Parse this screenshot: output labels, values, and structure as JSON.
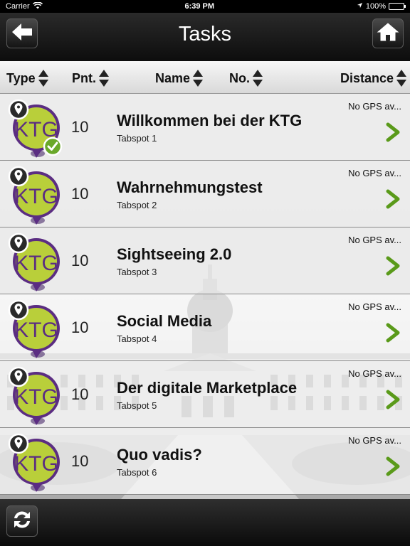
{
  "status_bar": {
    "carrier": "Carrier",
    "time": "6:39 PM",
    "battery": "100%",
    "battery_level": 1.0
  },
  "header": {
    "title": "Tasks",
    "back_icon": "arrow-left-icon",
    "home_icon": "home-icon"
  },
  "columns": [
    {
      "label": "Type"
    },
    {
      "label": "Pnt."
    },
    {
      "label": "Name"
    },
    {
      "label": "No."
    },
    {
      "label": "Distance"
    }
  ],
  "logo_text": "KTG",
  "colors": {
    "accent_green": "#5a9a1a",
    "logo_green": "#b9cf3a",
    "logo_purple": "#5b2d82"
  },
  "tasks": [
    {
      "points": "10",
      "title": "Willkommen bei der KTG",
      "subtitle": "Tabspot 1",
      "distance": "No GPS av...",
      "completed": true
    },
    {
      "points": "10",
      "title": "Wahrnehmungstest",
      "subtitle": "Tabspot 2",
      "distance": "No GPS av...",
      "completed": false
    },
    {
      "points": "10",
      "title": "Sightseeing 2.0",
      "subtitle": "Tabspot 3",
      "distance": "No GPS av...",
      "completed": false
    },
    {
      "points": "10",
      "title": "Social Media",
      "subtitle": "Tabspot 4",
      "distance": "No GPS av...",
      "completed": false
    },
    {
      "points": "10",
      "title": "Der digitale Marketplace",
      "subtitle": "Tabspot 5",
      "distance": "No GPS av...",
      "completed": false
    },
    {
      "points": "10",
      "title": "Quo vadis?",
      "subtitle": "Tabspot 6",
      "distance": "No GPS av...",
      "completed": false
    }
  ],
  "footer": {
    "refresh_icon": "refresh-icon"
  }
}
